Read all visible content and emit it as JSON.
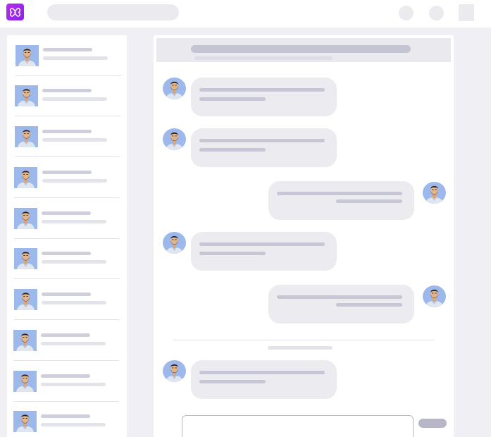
{
  "app": {
    "logo_icon": "brain-circuit-icon",
    "brand_color": "#a626ee"
  },
  "topbar": {
    "search_icon": "search-field-placeholder",
    "action_icons": [
      "notification-icon",
      "profile-icon",
      "menu-icon"
    ]
  },
  "sidebar": {
    "contact_count": 10
  },
  "chat": {
    "messages": [
      {
        "side": "incoming"
      },
      {
        "side": "incoming"
      },
      {
        "side": "outgoing"
      },
      {
        "side": "incoming"
      },
      {
        "side": "outgoing"
      },
      {
        "side": "incoming"
      }
    ]
  },
  "colors": {
    "page_bg": "#f0f0f4",
    "panel_bg": "#ffffff",
    "skeleton_dark": "#c6c6d4",
    "skeleton_light": "#e3e3ea",
    "bubble_bg": "#ebebf0",
    "avatar_bg": "#9bb8ec"
  }
}
